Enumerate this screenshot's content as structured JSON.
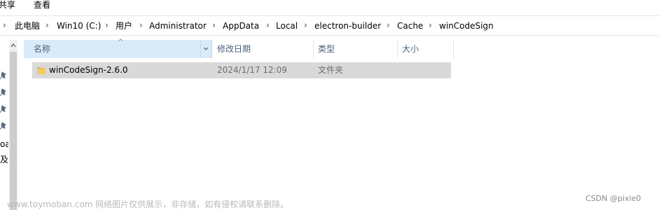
{
  "ribbon": {
    "tabs": [
      "共享",
      "查看"
    ]
  },
  "address_bar": {
    "crumbs": [
      "此电脑",
      "Win10 (C:)",
      "用户",
      "Administrator",
      "AppData",
      "Local",
      "electron-builder",
      "Cache",
      "winCodeSign"
    ],
    "separator": "›"
  },
  "nav_pane": {
    "partial_labels": [
      "oac",
      "及"
    ]
  },
  "file_list": {
    "columns": [
      "名称",
      "修改日期",
      "类型",
      "大小"
    ],
    "sort_indicator": "^",
    "rows": [
      {
        "name": "winCodeSign-2.6.0",
        "modified": "2024/1/17 12:09",
        "type": "文件夹",
        "size": ""
      }
    ]
  },
  "watermark": "www.toymoban.com 网络图片仅供展示，非存储，如有侵权请联系删除。",
  "credit": "CSDN @pixle0",
  "colors": {
    "header_bg": "#d9ebf9",
    "row_selected": "#d9d9d9",
    "folder": "#e8b44b"
  }
}
